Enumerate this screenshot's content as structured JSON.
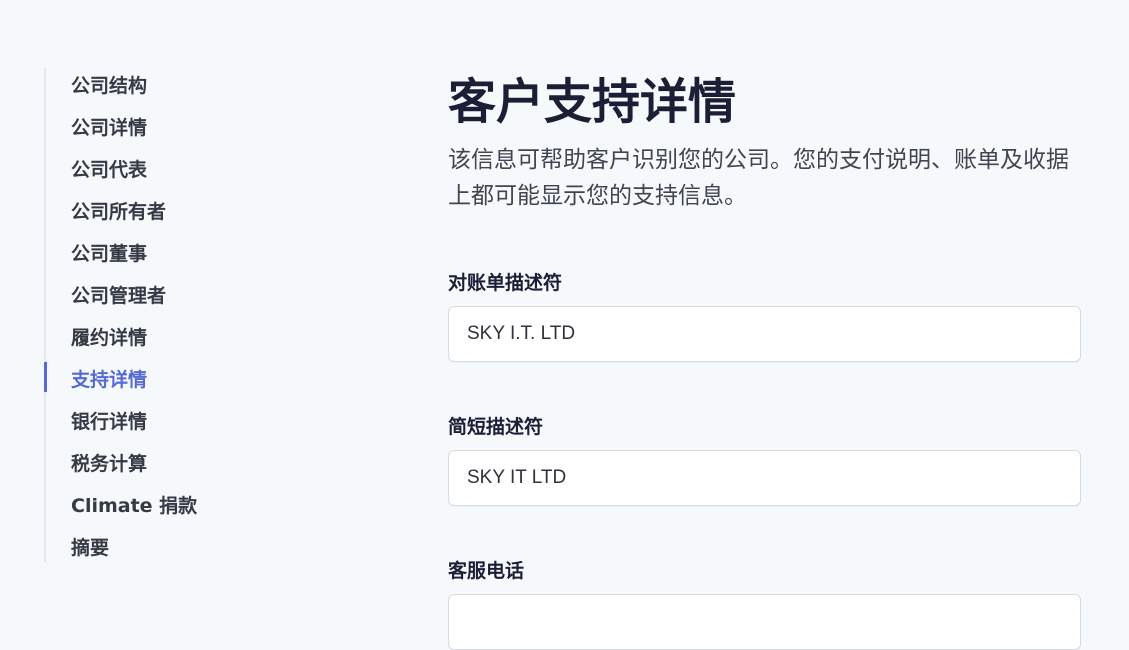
{
  "sidebar": {
    "items": [
      {
        "label": "公司结构",
        "active": false
      },
      {
        "label": "公司详情",
        "active": false
      },
      {
        "label": "公司代表",
        "active": false
      },
      {
        "label": "公司所有者",
        "active": false
      },
      {
        "label": "公司董事",
        "active": false
      },
      {
        "label": "公司管理者",
        "active": false
      },
      {
        "label": "履约详情",
        "active": false
      },
      {
        "label": "支持详情",
        "active": true
      },
      {
        "label": "银行详情",
        "active": false
      },
      {
        "label": "税务计算",
        "active": false
      },
      {
        "label": "Climate 捐款",
        "active": false
      },
      {
        "label": "摘要",
        "active": false
      }
    ]
  },
  "main": {
    "title": "客户支持详情",
    "description": "该信息可帮助客户识别您的公司。您的支付说明、账单及收据上都可能显示您的支持信息。",
    "fields": [
      {
        "label": "对账单描述符",
        "value": "SKY I.T. LTD"
      },
      {
        "label": "简短描述符",
        "value": "SKY IT LTD"
      },
      {
        "label": "客服电话",
        "value": ""
      }
    ]
  },
  "colors": {
    "accent": "#5469d4",
    "background": "#f6f9fc",
    "text": "#30313d",
    "border": "#d5dbe1"
  }
}
